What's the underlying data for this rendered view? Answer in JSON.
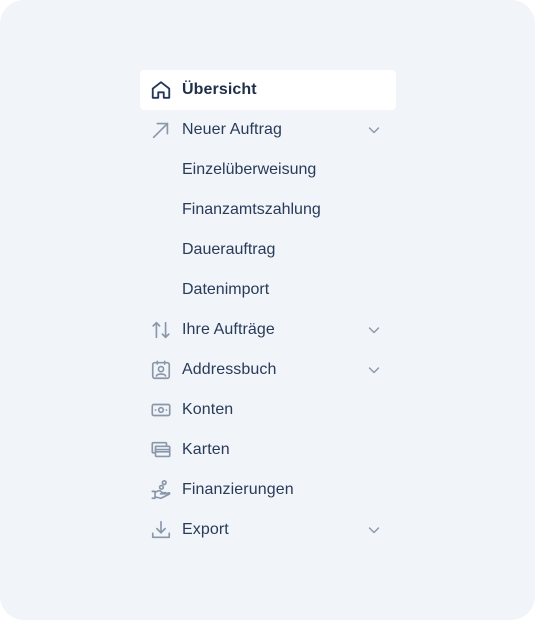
{
  "nav": {
    "overview": {
      "label": "Übersicht",
      "icon": "home-icon"
    },
    "new_order": {
      "label": "Neuer Auftrag",
      "icon": "arrow-up-right-icon",
      "children": [
        "Einzelüberweisung",
        "Finanzamtszahlung",
        "Dauerauftrag",
        "Datenimport"
      ]
    },
    "your_orders": {
      "label": "Ihre Aufträge",
      "icon": "arrows-up-down-icon"
    },
    "address_book": {
      "label": "Addressbuch",
      "icon": "contact-card-icon"
    },
    "accounts": {
      "label": "Konten",
      "icon": "banknote-icon"
    },
    "cards": {
      "label": "Karten",
      "icon": "credit-cards-icon"
    },
    "financing": {
      "label": "Finanzierungen",
      "icon": "hand-coin-icon"
    },
    "export": {
      "label": "Export",
      "icon": "download-icon"
    }
  },
  "colors": {
    "panel_bg": "#f1f4f8",
    "active_bg": "#ffffff",
    "text": "#283b59",
    "icon": "#8a97ab"
  }
}
